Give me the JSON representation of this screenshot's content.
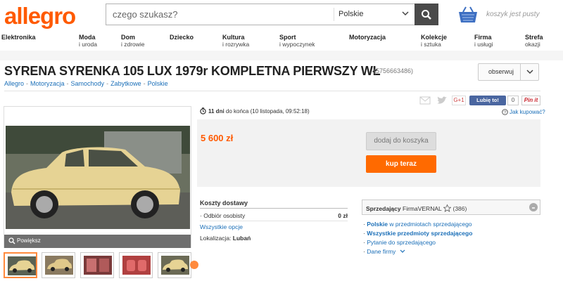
{
  "header": {
    "logo": "allegro",
    "search_placeholder": "czego szukasz?",
    "search_category": "Polskie",
    "cart_text": "koszyk jest pusty"
  },
  "categories": [
    {
      "line1": "Elektronika",
      "line2": ""
    },
    {
      "line1": "Moda",
      "line2": "i uroda"
    },
    {
      "line1": "Dom",
      "line2": "i zdrowie"
    },
    {
      "line1": "Dziecko",
      "line2": ""
    },
    {
      "line1": "Kultura",
      "line2": "i rozrywka"
    },
    {
      "line1": "Sport",
      "line2": "i wypoczynek"
    },
    {
      "line1": "Motoryzacja",
      "line2": ""
    },
    {
      "line1": "Kolekcje",
      "line2": "i sztuka"
    },
    {
      "line1": "Firma",
      "line2": "i usługi"
    },
    {
      "line1": "Strefa",
      "line2": "okazji"
    }
  ],
  "offer": {
    "title": "SYRENA SYRENKA 105 LUX 1979r KOMPLETNA PIERWSZY WŁ",
    "id": "(5756663486)",
    "watch_label": "obserwuj",
    "breadcrumb": [
      "Allegro",
      "Motoryzacja",
      "Samochody",
      "Zabytkowe",
      "Polskie"
    ],
    "share": {
      "gplus": "G+1",
      "like": "Lubię to!",
      "like_count": "0",
      "pinit": "Pin it"
    },
    "timer_bold": "11 dni",
    "timer_rest": " do końca (10 listopada, 09:52:18)",
    "help_link": "Jak kupować?",
    "price": "5 600 zł",
    "basket_btn": "dodaj do koszyka",
    "buy_btn": "kup teraz",
    "zoom_label": "Powiększ"
  },
  "shipping": {
    "title": "Koszty dostawy",
    "row_label": "Odbiór osobisty",
    "row_value": "0 zł",
    "all_options": "Wszystkie opcje",
    "location_label": "Lokalizacja:",
    "location_value": "Lubań"
  },
  "seller": {
    "label": "Sprzedający",
    "name": "FirmaVERNAL",
    "rating": "(386)",
    "link1_bold": "Polskie",
    "link1_rest": " w przedmiotach sprzedającego",
    "link2": "Wszystkie przedmioty sprzedającego",
    "link3": "Pytanie do sprzedającego",
    "link4": "Dane firmy"
  },
  "colors": {
    "brand": "#ff5a00",
    "link": "#1b6fb8",
    "buy": "#ff6a00"
  }
}
